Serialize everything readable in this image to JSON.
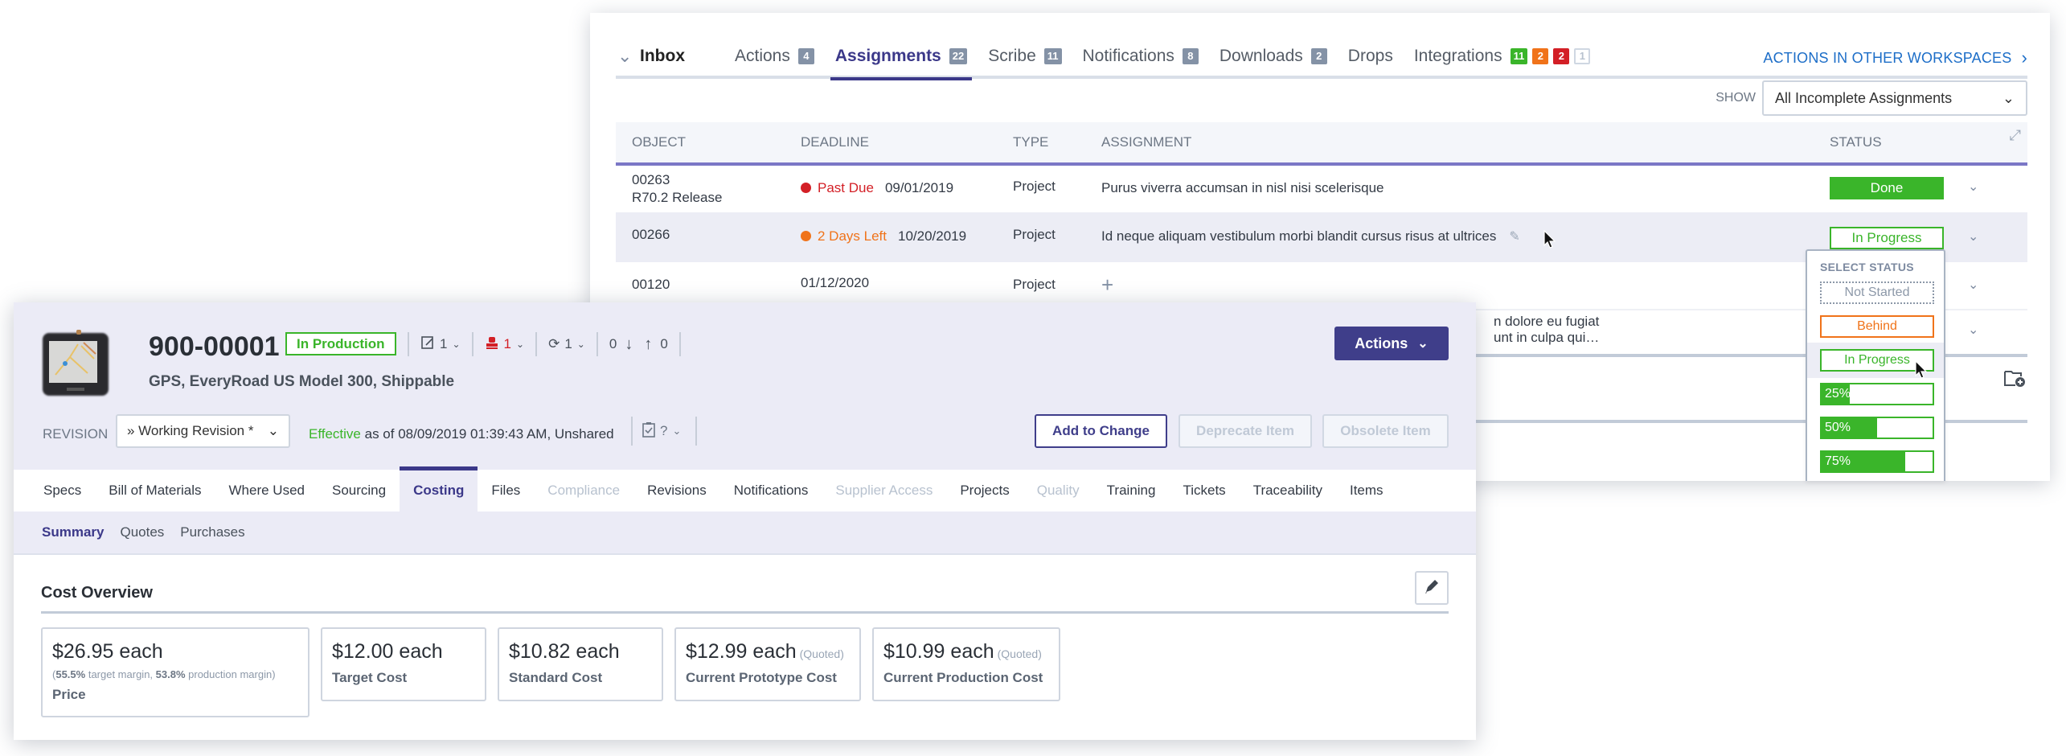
{
  "inbox": {
    "title": "Inbox",
    "tabs": [
      {
        "label": "Actions",
        "badges": [
          {
            "value": "4",
            "color": "gray"
          }
        ]
      },
      {
        "label": "Assignments",
        "badges": [
          {
            "value": "22",
            "color": "gray"
          }
        ],
        "active": true
      },
      {
        "label": "Scribe",
        "badges": [
          {
            "value": "11",
            "color": "gray"
          }
        ]
      },
      {
        "label": "Notifications",
        "badges": [
          {
            "value": "8",
            "color": "gray"
          }
        ]
      },
      {
        "label": "Downloads",
        "badges": [
          {
            "value": "2",
            "color": "gray"
          }
        ]
      },
      {
        "label": "Drops",
        "badges": []
      },
      {
        "label": "Integrations",
        "badges": [
          {
            "value": "11",
            "color": "green"
          },
          {
            "value": "2",
            "color": "orange"
          },
          {
            "value": "2",
            "color": "red"
          },
          {
            "value": "1",
            "color": "empty"
          }
        ]
      }
    ],
    "other_workspaces_link": "ACTIONS IN OTHER WORKSPACES",
    "show_label": "SHOW",
    "show_value": "All Incomplete Assignments",
    "columns": {
      "object": "OBJECT",
      "deadline": "DEADLINE",
      "type": "TYPE",
      "assignment": "ASSIGNMENT",
      "status": "STATUS"
    },
    "rows": [
      {
        "object": "00263",
        "object_sub": "R70.2 Release",
        "due_label": "Past Due",
        "due_color": "#d31f26",
        "deadline": "09/01/2019",
        "type": "Project",
        "assignment": "Purus viverra accumsan in nisl nisi scelerisque",
        "status": "Done"
      },
      {
        "object": "00266",
        "object_sub": "",
        "due_label": "2 Days Left",
        "due_color": "#f0731a",
        "deadline": "10/20/2019",
        "type": "Project",
        "assignment": "Id neque aliquam vestibulum morbi blandit cursus risus at ultrices",
        "status": "In Progress"
      },
      {
        "object": "00120",
        "object_sub": "",
        "due_label": "",
        "deadline": "01/12/2020",
        "type": "Project",
        "assignment": "",
        "status": ""
      },
      {
        "assignment_line1": "n dolore eu fugiat",
        "assignment_line2": "unt in culpa qui…"
      }
    ],
    "status_dropdown": {
      "title": "SELECT STATUS",
      "options": [
        {
          "label": "Not Started"
        },
        {
          "label": "Behind"
        },
        {
          "label": "In Progress",
          "hovered": true
        },
        {
          "label": "25%",
          "progress": 0.25
        },
        {
          "label": "50%",
          "progress": 0.5
        },
        {
          "label": "75%",
          "progress": 0.75
        }
      ]
    }
  },
  "item": {
    "number": "900-00001",
    "lifecycle": "In Production",
    "counters": {
      "changes": "1",
      "stamps": "1",
      "cycles": "1",
      "down": "0",
      "up": "0"
    },
    "description": "GPS, EveryRoad US Model 300, Shippable",
    "actions_label": "Actions",
    "revision_label": "REVISION",
    "revision_value": "» Working Revision *",
    "effective_word": "Effective",
    "effective_rest": " as of 08/09/2019 01:39:43 AM, Unshared",
    "help_glyph": "?",
    "buttons": {
      "add_to_change": "Add to Change",
      "deprecate": "Deprecate Item",
      "obsolete": "Obsolete Item"
    },
    "tabs": [
      {
        "label": "Specs"
      },
      {
        "label": "Bill of Materials"
      },
      {
        "label": "Where Used"
      },
      {
        "label": "Sourcing"
      },
      {
        "label": "Costing",
        "active": true
      },
      {
        "label": "Files"
      },
      {
        "label": "Compliance",
        "disabled": true
      },
      {
        "label": "Revisions"
      },
      {
        "label": "Notifications"
      },
      {
        "label": "Supplier Access",
        "disabled": true
      },
      {
        "label": "Projects"
      },
      {
        "label": "Quality",
        "disabled": true
      },
      {
        "label": "Training"
      },
      {
        "label": "Tickets"
      },
      {
        "label": "Traceability"
      },
      {
        "label": "Items"
      }
    ],
    "subtabs": [
      {
        "label": "Summary",
        "active": true
      },
      {
        "label": "Quotes"
      },
      {
        "label": "Purchases"
      }
    ],
    "cost_overview": {
      "title": "Cost Overview",
      "cards": [
        {
          "value": "$26.95 each",
          "qualifier": "",
          "target_margin": "55.5%",
          "target_margin_text": " target margin, ",
          "production_margin": "53.8%",
          "production_margin_text": " production margin)",
          "label": "Price"
        },
        {
          "value": "$12.00 each",
          "qualifier": "",
          "label": "Target Cost"
        },
        {
          "value": "$10.82 each",
          "qualifier": "",
          "label": "Standard Cost"
        },
        {
          "value": "$12.99 each",
          "qualifier": "(Quoted)",
          "label": "Current Prototype Cost"
        },
        {
          "value": "$10.99 each",
          "qualifier": "(Quoted)",
          "label": "Current Production Cost"
        }
      ]
    }
  },
  "colors": {
    "brand": "#3f3e8a",
    "success": "#3ab52a",
    "warning": "#f0731a",
    "danger": "#d31f26",
    "link": "#1d6ec8"
  }
}
